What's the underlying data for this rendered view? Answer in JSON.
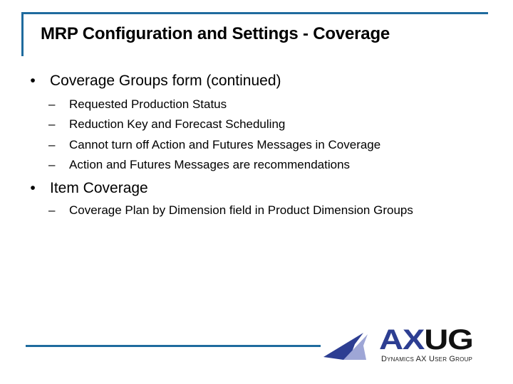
{
  "slide": {
    "title": "MRP Configuration and Settings - Coverage",
    "accent_color": "#1f6b9e",
    "bullets": [
      {
        "mark": "•",
        "text": "Coverage Groups form (continued)",
        "sub": [
          {
            "mark": "–",
            "text": "Requested Production Status"
          },
          {
            "mark": "–",
            "text": "Reduction Key and Forecast Scheduling"
          },
          {
            "mark": "–",
            "text": "Cannot turn off Action and Futures Messages in Coverage"
          },
          {
            "mark": "–",
            "text": "Action and Futures Messages are recommendations"
          }
        ]
      },
      {
        "mark": "•",
        "text": "Item Coverage",
        "sub": [
          {
            "mark": "–",
            "text": "Coverage Plan by Dimension field in Product Dimension Groups"
          }
        ]
      }
    ]
  },
  "logo": {
    "word_part1": "AX",
    "word_part2": "UG",
    "subtitle": "Dynamics AX User Group",
    "color_primary": "#2d3e92",
    "color_secondary": "#9ea6d6",
    "color_dark": "#111111"
  }
}
